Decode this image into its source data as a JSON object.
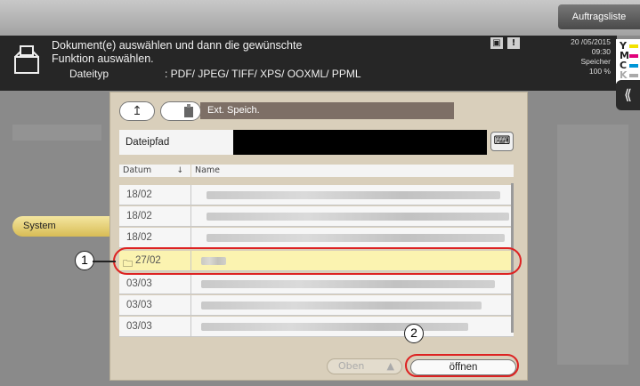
{
  "topbar": {
    "jobs_button": "Auftragsliste"
  },
  "header": {
    "message_line1": "Dokument(e) auswählen und dann die gewünschte",
    "message_line2": "Funktion auswählen.",
    "filetype_label": "Dateityp",
    "filetype_value": ": PDF/ JPEG/ TIFF/ XPS/ OOXML/ PPML",
    "date": "20 /05/2015",
    "time": "09:30",
    "storage_label": "Speicher",
    "storage_value": "100 %",
    "toner": [
      {
        "letter": "Y",
        "color": "#f2e200"
      },
      {
        "letter": "M",
        "color": "#e0007a"
      },
      {
        "letter": "C",
        "color": "#0096d6"
      },
      {
        "letter": "K",
        "color": "#222222"
      }
    ],
    "collapse_icon": "double-chevron-left-icon"
  },
  "sidebar": {
    "system_tab": "System"
  },
  "dialog": {
    "storage_name": "Ext. Speich.",
    "path_label": "Dateipfad",
    "path_value": "",
    "columns": {
      "date": "Datum",
      "name": "Name"
    },
    "rows": [
      {
        "date": "18/02",
        "selected": false,
        "folder": false
      },
      {
        "date": "18/02",
        "selected": false,
        "folder": false
      },
      {
        "date": "18/02",
        "selected": false,
        "folder": false
      },
      {
        "date": "27/02",
        "selected": true,
        "folder": true
      },
      {
        "date": "03/03",
        "selected": false,
        "folder": false
      },
      {
        "date": "03/03",
        "selected": false,
        "folder": false
      },
      {
        "date": "03/03",
        "selected": false,
        "folder": false
      }
    ],
    "up_button": "Oben",
    "open_button": "öffnen"
  },
  "callouts": [
    "1",
    "2"
  ],
  "colors": {
    "accent": "#d8bc55",
    "highlight_ring": "#dd2222",
    "dialog_bg": "#d9cfbb"
  }
}
